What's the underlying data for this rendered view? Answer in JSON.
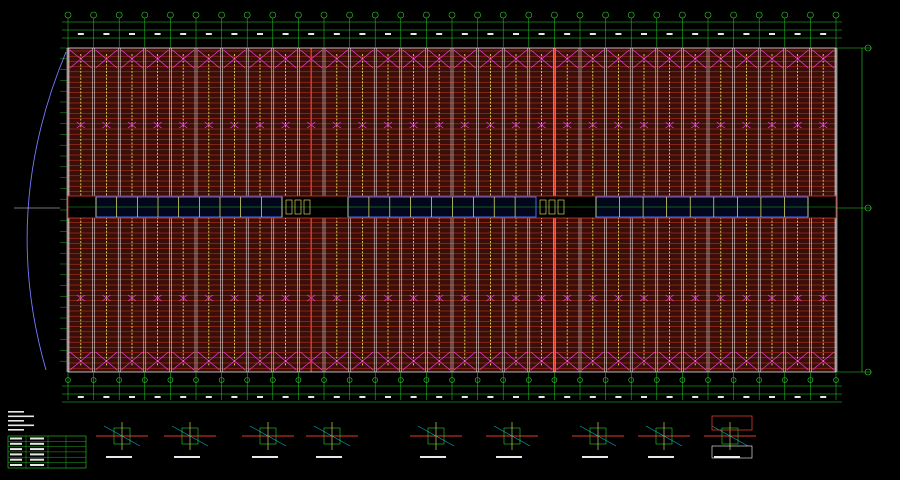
{
  "drawing": {
    "grid_columns": 30,
    "detail_count": 10,
    "colors": {
      "background": "#000000",
      "axis": "#2bd32b",
      "purlin": "#cc3a1c",
      "brace": "#ff3dff",
      "tie": "#f5f06a",
      "frame": "#ffffff",
      "arc": "#7a7aff",
      "beam": "#e03a2a",
      "bracing_box": "#3b6cff"
    }
  }
}
